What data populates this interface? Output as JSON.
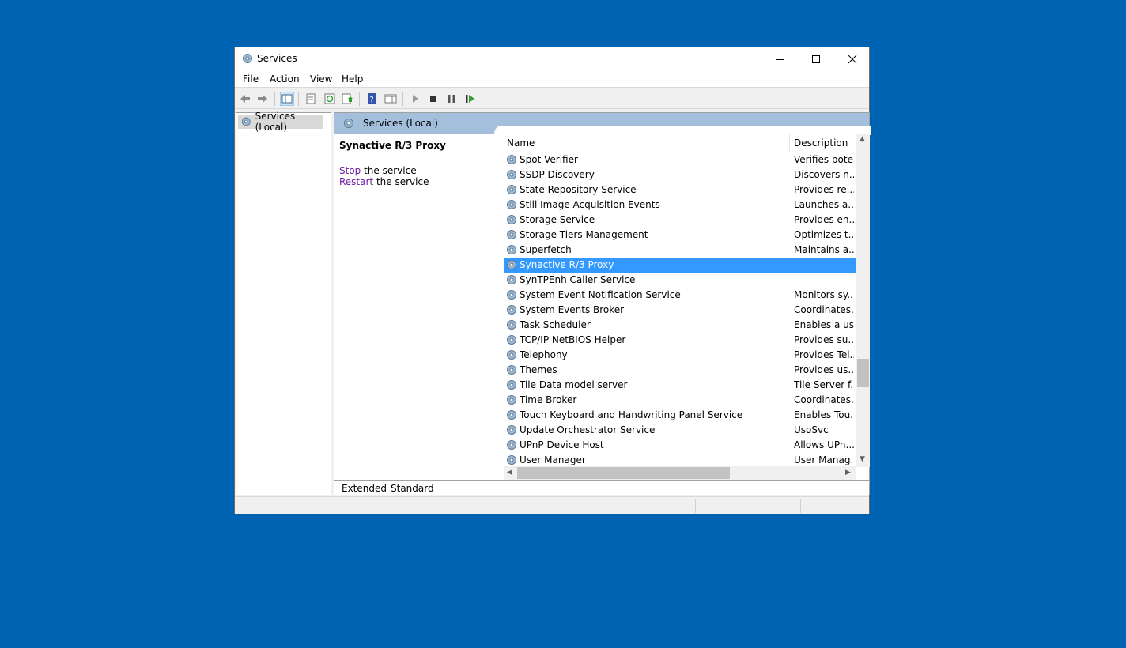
{
  "window": {
    "title": "Services",
    "icon": "services-gear-icon"
  },
  "window_controls": {
    "minimize_icon": "minimize-icon",
    "maximize_icon": "maximize-icon",
    "close_icon": "close-icon"
  },
  "menu": [
    "File",
    "Action",
    "View",
    "Help"
  ],
  "toolbar": {
    "buttons": [
      "back-arrow-icon",
      "forward-arrow-icon",
      "show-console-tree-icon",
      "export-list-icon",
      "refresh-icon",
      "properties-icon",
      "help-icon",
      "show-action-pane-icon",
      "start-service-icon",
      "stop-service-icon",
      "pause-service-icon",
      "restart-service-icon"
    ]
  },
  "tree": {
    "item": "Services (Local)"
  },
  "main": {
    "header": "Services (Local)",
    "selected_service": "Synactive R/3 Proxy",
    "actions": [
      {
        "link": "Stop",
        "rest": " the service"
      },
      {
        "link": "Restart",
        "rest": " the service"
      }
    ],
    "columns": {
      "name": "Name",
      "description": "Description"
    },
    "rows": [
      {
        "name": "Spot Verifier",
        "desc": "Verifies pote..."
      },
      {
        "name": "SSDP Discovery",
        "desc": "Discovers n..."
      },
      {
        "name": "State Repository Service",
        "desc": "Provides re..."
      },
      {
        "name": "Still Image Acquisition Events",
        "desc": "Launches a..."
      },
      {
        "name": "Storage Service",
        "desc": "Provides en..."
      },
      {
        "name": "Storage Tiers Management",
        "desc": "Optimizes t..."
      },
      {
        "name": "Superfetch",
        "desc": "Maintains a..."
      },
      {
        "name": "Synactive R/3 Proxy",
        "desc": "",
        "selected": true
      },
      {
        "name": "SynTPEnh Caller Service",
        "desc": ""
      },
      {
        "name": "System Event Notification Service",
        "desc": "Monitors sy..."
      },
      {
        "name": "System Events Broker",
        "desc": "Coordinates..."
      },
      {
        "name": "Task Scheduler",
        "desc": "Enables a us..."
      },
      {
        "name": "TCP/IP NetBIOS Helper",
        "desc": "Provides su..."
      },
      {
        "name": "Telephony",
        "desc": "Provides Tel..."
      },
      {
        "name": "Themes",
        "desc": "Provides us..."
      },
      {
        "name": "Tile Data model server",
        "desc": "Tile Server f..."
      },
      {
        "name": "Time Broker",
        "desc": "Coordinates..."
      },
      {
        "name": "Touch Keyboard and Handwriting Panel Service",
        "desc": "Enables Tou..."
      },
      {
        "name": "Update Orchestrator Service",
        "desc": "UsoSvc"
      },
      {
        "name": "UPnP Device Host",
        "desc": "Allows UPn..."
      },
      {
        "name": "User Manager",
        "desc": "User Manag..."
      }
    ]
  },
  "tabs": [
    "Extended",
    "Standard"
  ],
  "colors": {
    "desktop": "#0063b1",
    "header": "#a3bfdc",
    "selection": "#3399ff",
    "link": "#6b1fa0"
  }
}
